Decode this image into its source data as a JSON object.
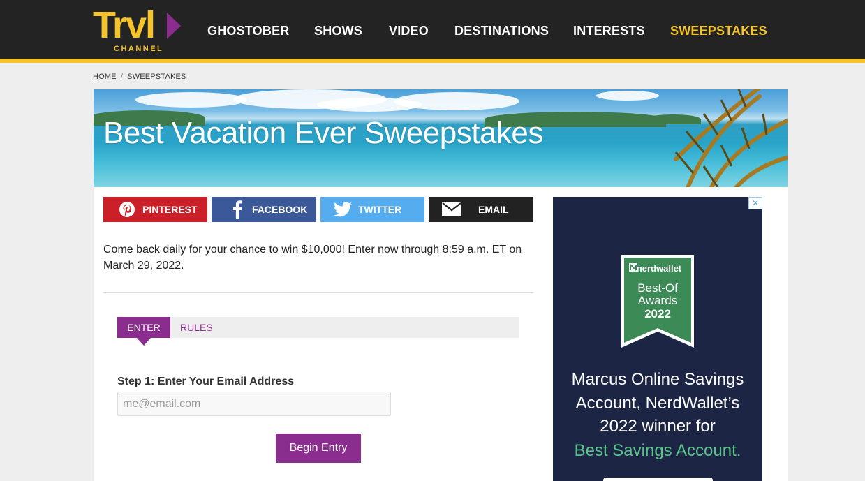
{
  "header": {
    "logo_text": "Trvl",
    "logo_sub": "CHANNEL",
    "nav": [
      {
        "label": "GHOSTOBER"
      },
      {
        "label": "SHOWS"
      },
      {
        "label": "VIDEO"
      },
      {
        "label": "DESTINATIONS"
      },
      {
        "label": "INTERESTS"
      },
      {
        "label": "SWEEPSTAKES",
        "active": true
      }
    ],
    "accent_color": "#f4c42a",
    "brand_purple": "#8a2d8e"
  },
  "breadcrumb": {
    "items": [
      "HOME",
      "SWEEPSTAKES"
    ],
    "separator": "/"
  },
  "hero": {
    "title": "Best Vacation Ever Sweepstakes"
  },
  "share": {
    "pinterest": {
      "label": "PINTEREST",
      "icon": "pinterest-icon",
      "color": "#cb2027"
    },
    "facebook": {
      "label": "FACEBOOK",
      "icon": "facebook-icon",
      "color": "#3b5998"
    },
    "twitter": {
      "label": "TWITTER",
      "icon": "twitter-icon",
      "color": "#55acee"
    },
    "email": {
      "label": "EMAIL",
      "icon": "envelope-icon",
      "color": "#222222"
    }
  },
  "intro": "Come back daily for your chance to win $10,000! Enter now through 8:59 a.m. ET on March 29, 2022.",
  "tabs": [
    {
      "label": "ENTER",
      "active": true
    },
    {
      "label": "RULES"
    }
  ],
  "form": {
    "step_label": "Step 1: Enter Your Email Address",
    "email_placeholder": "me@email.com",
    "email_value": "",
    "submit_label": "Begin Entry"
  },
  "ad": {
    "close_label": "✕",
    "badge_brand": "nerdwallet",
    "badge_line1": "Best-Of",
    "badge_line2": "Awards",
    "badge_year": "2022",
    "text_lines": [
      "Marcus Online Savings",
      "Account, NerdWallet’s",
      "2022 winner for"
    ],
    "highlight": "Best Savings Account.",
    "highlight_color": "#5bc48a",
    "background": "#1d2545"
  }
}
